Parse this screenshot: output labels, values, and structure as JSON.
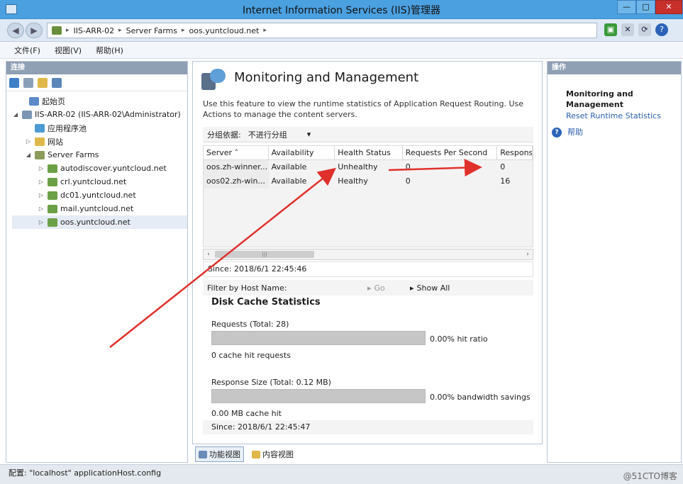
{
  "window": {
    "title": "Internet Information Services (IIS)管理器",
    "min": "—",
    "max": "□",
    "close": "✕"
  },
  "address": {
    "crumbs": [
      "IIS-ARR-02",
      "Server Farms",
      "oos.yuntcloud.net"
    ],
    "sep": "▸"
  },
  "menu": {
    "items": [
      "文件(F)",
      "视图(V)",
      "帮助(H)"
    ]
  },
  "connections": {
    "header": "连接",
    "tree": [
      {
        "label": "起始页",
        "icon": "home-icon",
        "expander": ""
      },
      {
        "label": "IIS-ARR-02 (IIS-ARR-02\\Administrator)",
        "icon": "server-icon",
        "expander": "◢"
      },
      {
        "label": "应用程序池",
        "icon": "pool-icon",
        "expander": ""
      },
      {
        "label": "网站",
        "icon": "folder-icon",
        "expander": "▷"
      },
      {
        "label": "Server Farms",
        "icon": "farm-icon",
        "expander": "◢"
      },
      {
        "label": "autodiscover.yuntcloud.net",
        "icon": "node-icon",
        "expander": "▷"
      },
      {
        "label": "crl.yuntcloud.net",
        "icon": "node-icon",
        "expander": "▷"
      },
      {
        "label": "dc01.yuntcloud.net",
        "icon": "node-icon",
        "expander": "▷"
      },
      {
        "label": "mail.yuntcloud.net",
        "icon": "node-icon",
        "expander": "▷"
      },
      {
        "label": "oos.yuntcloud.net",
        "icon": "node-icon",
        "expander": "▷"
      }
    ]
  },
  "feature": {
    "title": "Monitoring and Management",
    "description": "Use this feature to view the runtime statistics of Application Request Routing. Use Actions to manage the content servers.",
    "group_by_label": "分组依据:",
    "group_by_value": "不进行分组",
    "group_by_arrow": "▾",
    "columns": [
      "Server",
      "Availability",
      "Health Status",
      "Requests Per Second",
      "Respons"
    ],
    "sort_arrow": "˄",
    "rows": [
      [
        "oos.zh-winner...",
        "Available",
        "Unhealthy",
        "0",
        "0"
      ],
      [
        "oos02.zh-win...",
        "Available",
        "Healthy",
        "0",
        "16"
      ]
    ],
    "scroll_left": "‹",
    "scroll_right": "›",
    "scroll_grip": "|||",
    "since_top": "Since: 2018/6/1 22:45:46",
    "filter_label": "Filter by Host Name:",
    "go_label": "Go",
    "show_all_label": "Show All",
    "disk_title": "Disk Cache Statistics",
    "requests_label": "Requests (Total: 28)",
    "hit_ratio": 0.0,
    "hit_ratio_label": "0.00% hit ratio",
    "cache_hit_requests": "0 cache hit requests",
    "response_size_label": "Response Size (Total: 0.12 MB)",
    "bandwidth_savings": 0.0,
    "bandwidth_label": "0.00% bandwidth savings",
    "cache_hit_mb": "0.00 MB cache hit",
    "since_bottom": "Since: 2018/6/1 22:45:47"
  },
  "view_tabs": [
    "功能视图",
    "内容视图"
  ],
  "actions": {
    "header": "操作",
    "group_title": "Monitoring and Management",
    "reset_link": "Reset Runtime Statistics",
    "help": "帮助"
  },
  "status": {
    "text": "配置: \"localhost\" applicationHost.config",
    "watermark": "@51CTO博客"
  },
  "colors": {
    "accent": "#4ba0e0",
    "link": "#2a5fad",
    "annotation_arrow": "#e0302b"
  }
}
